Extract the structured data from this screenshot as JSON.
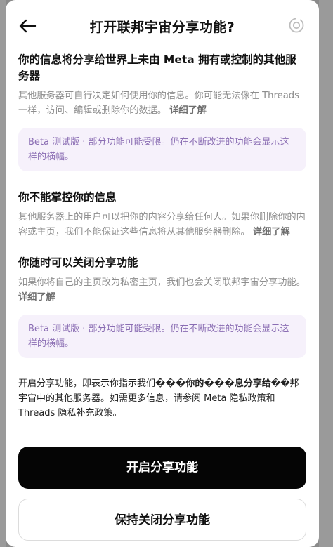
{
  "header": {
    "title": "打开联邦宇宙分享功能?"
  },
  "sections": [
    {
      "title": "你的信息将分享给世界上未由 Meta 拥有或控制的其他服务器",
      "body": "其他服务器可自行决定如何使用你的信息。你可能无法像在 Threads 一样，访问、编辑或删除你的数据。",
      "link": "详细了解"
    },
    {
      "title": "你不能掌控你的信息",
      "body": "其他服务器上的用户可以把你的内容分享给任何人。如果你删除你的内容或主页，我们不能保证这些信息将从其他服务器删除。",
      "link": "详细了解"
    },
    {
      "title": "你随时可以关闭分享功能",
      "body": "如果你将自己的主页改为私密主页，我们也会关闭联邦宇宙分享功能。",
      "link": "详细了解"
    }
  ],
  "beta_banner": "Beta 测试版 · 部分功能可能受限。仍在不断改进的功能会显示这样的横幅。",
  "footer": {
    "part1": "开启分享功能，即表示你指示我们",
    "bold1": "���你的���息分享给",
    "part2": "��邦宇宙中的其他服务器。如需更多信息，请参阅 Meta 隐私政策和 Threads 隐私补充政策。"
  },
  "buttons": {
    "enable": "开启分享功能",
    "keep_off": "保持关闭分享功能"
  },
  "icons": {
    "back": "arrow-left-icon",
    "settings": "settings-ring-icon"
  }
}
